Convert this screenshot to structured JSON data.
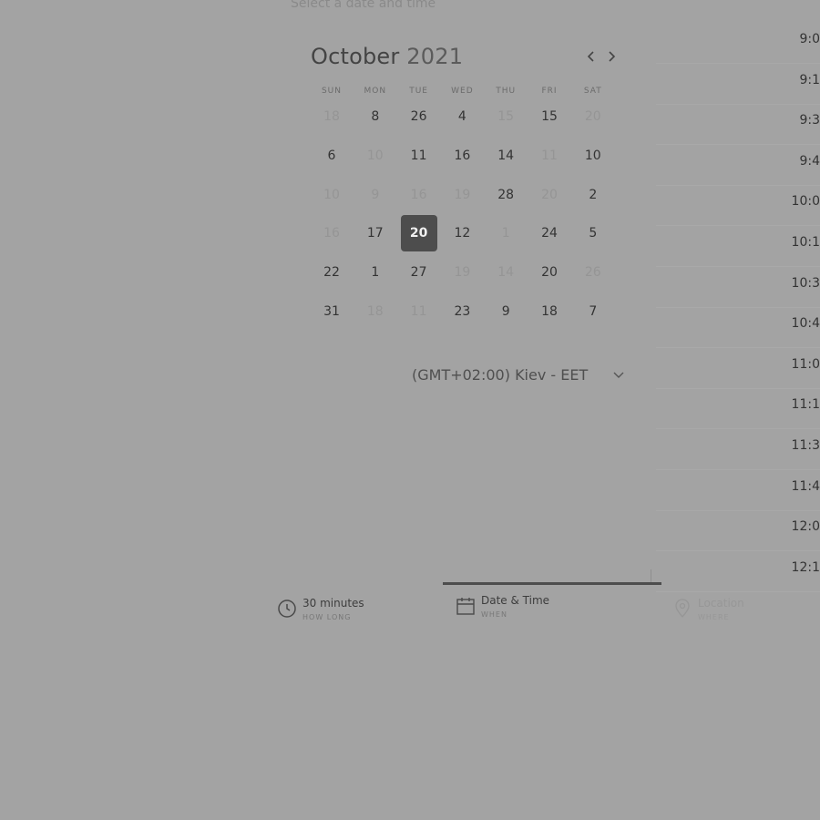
{
  "header": {
    "hint": "Select a date and time"
  },
  "calendar": {
    "month": "October",
    "year": "2021",
    "prev_icon": "chevron-left-icon",
    "next_icon": "chevron-right-icon",
    "weekdays": [
      "SUN",
      "MON",
      "TUE",
      "WED",
      "THU",
      "FRI",
      "SAT"
    ],
    "weeks": [
      [
        {
          "d": "18",
          "on": false
        },
        {
          "d": "8",
          "on": true
        },
        {
          "d": "26",
          "on": true
        },
        {
          "d": "4",
          "on": true
        },
        {
          "d": "15",
          "on": false
        },
        {
          "d": "15",
          "on": true
        },
        {
          "d": "20",
          "on": false
        }
      ],
      [
        {
          "d": "6",
          "on": true
        },
        {
          "d": "10",
          "on": false
        },
        {
          "d": "11",
          "on": true
        },
        {
          "d": "16",
          "on": true
        },
        {
          "d": "14",
          "on": true
        },
        {
          "d": "11",
          "on": false
        },
        {
          "d": "10",
          "on": true
        }
      ],
      [
        {
          "d": "10",
          "on": false
        },
        {
          "d": "9",
          "on": false
        },
        {
          "d": "16",
          "on": false
        },
        {
          "d": "19",
          "on": false
        },
        {
          "d": "28",
          "on": true
        },
        {
          "d": "20",
          "on": false
        },
        {
          "d": "2",
          "on": true
        }
      ],
      [
        {
          "d": "16",
          "on": false
        },
        {
          "d": "17",
          "on": true
        },
        {
          "d": "20",
          "on": true,
          "selected": true
        },
        {
          "d": "12",
          "on": true
        },
        {
          "d": "1",
          "on": false
        },
        {
          "d": "24",
          "on": true
        },
        {
          "d": "5",
          "on": true
        }
      ],
      [
        {
          "d": "22",
          "on": true
        },
        {
          "d": "1",
          "on": true
        },
        {
          "d": "27",
          "on": true
        },
        {
          "d": "19",
          "on": false
        },
        {
          "d": "14",
          "on": false
        },
        {
          "d": "20",
          "on": true
        },
        {
          "d": "26",
          "on": false
        }
      ],
      [
        {
          "d": "31",
          "on": true
        },
        {
          "d": "18",
          "on": false
        },
        {
          "d": "11",
          "on": false
        },
        {
          "d": "23",
          "on": true
        },
        {
          "d": "9",
          "on": true
        },
        {
          "d": "18",
          "on": true
        },
        {
          "d": "7",
          "on": true
        }
      ]
    ]
  },
  "timezone": {
    "label": "(GMT+02:00) Kiev - EET",
    "icon": "chevron-down-icon"
  },
  "time_slots": [
    "9:0",
    "9:1",
    "9:3",
    "9:4",
    "10:0",
    "10:1",
    "10:3",
    "10:4",
    "11:0",
    "11:1",
    "11:3",
    "11:4",
    "12:0",
    "12:1"
  ],
  "steps": [
    {
      "title": "30 minutes",
      "sub": "HOW LONG",
      "icon": "clock-icon",
      "state": "done"
    },
    {
      "title": "Date & Time",
      "sub": "WHEN",
      "icon": "calendar-icon",
      "state": "active"
    },
    {
      "title": "Location",
      "sub": "WHERE",
      "icon": "location-pin-icon",
      "state": "pending"
    }
  ],
  "colors": {
    "overlay": "#a3a3a3",
    "selected": "#4d4d4d",
    "text": "#333333",
    "disabled": "#959595"
  }
}
